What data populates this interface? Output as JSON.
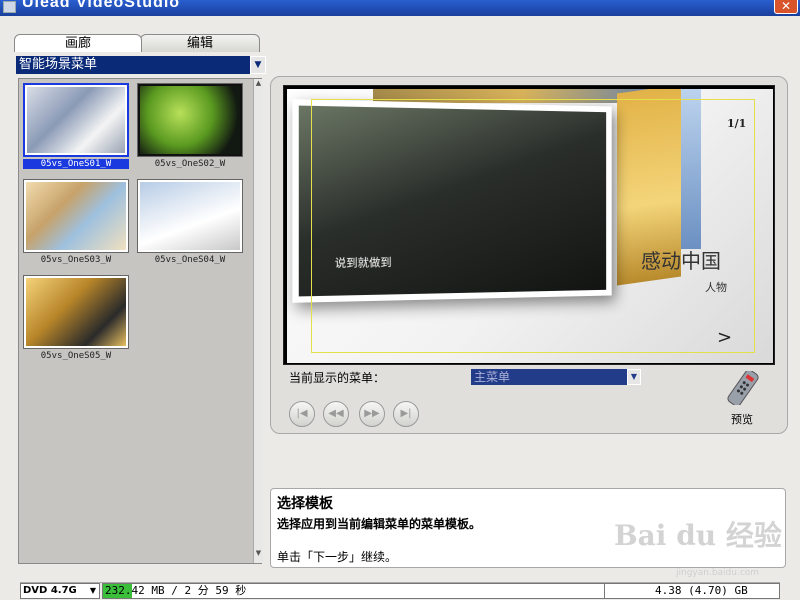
{
  "window": {
    "title": "Ulead VideoStudio"
  },
  "left_panel": {
    "tabs": [
      {
        "label": "画廊"
      },
      {
        "label": "编辑"
      }
    ],
    "menu_category": "智能场景菜单",
    "thumbnails": [
      {
        "label": "05vs_OneS01_W",
        "selected": true
      },
      {
        "label": "05vs_OneS02_W",
        "selected": false
      },
      {
        "label": "05vs_OneS03_W",
        "selected": false
      },
      {
        "label": "05vs_OneS04_W",
        "selected": false
      },
      {
        "label": "05vs_OneS05_W",
        "selected": false
      }
    ]
  },
  "preview": {
    "page_number": "1/1",
    "photo_caption": "说到就做到",
    "title_text": "感动中国",
    "subtitle_text": "人物",
    "next_arrow": ">",
    "current_menu_label": "当前显示的菜单：",
    "current_menu_value": "主菜单",
    "preview_button_label": "预览",
    "nav_buttons": [
      {
        "icon": "skip-to-start-icon",
        "glyph": "|◀"
      },
      {
        "icon": "rewind-icon",
        "glyph": "◀◀"
      },
      {
        "icon": "fast-forward-icon",
        "glyph": "▶▶"
      },
      {
        "icon": "skip-to-end-icon",
        "glyph": "▶|"
      }
    ]
  },
  "info": {
    "title": "选择模板",
    "description": "选择应用到当前编辑菜单的菜单模板。",
    "hint": "单击「下一步」继续。"
  },
  "watermark": {
    "logo_text": "Bai du 经验",
    "url": "jingyan.baidu.com"
  },
  "status_bar": {
    "disc_type": "DVD 4.7G",
    "usage_text": "232.42 MB /  2 分 59 秒",
    "usage_fraction": 0.05,
    "capacity_text": "4.38 (4.70) GB"
  },
  "colors": {
    "selection": "#1a3adf",
    "titlebar": "#2a5fd0",
    "usage_fill": "#3bbf3b"
  }
}
